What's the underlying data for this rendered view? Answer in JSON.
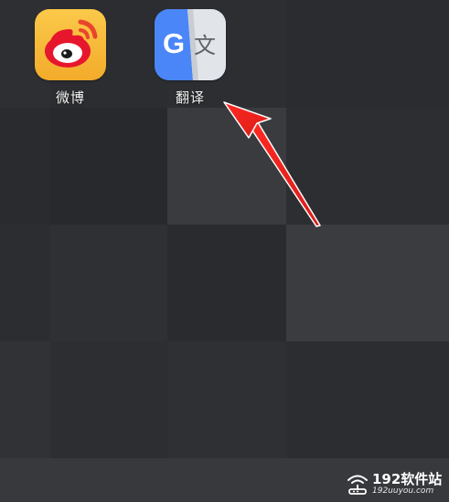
{
  "screen": {
    "background": "#2b2c30"
  },
  "apps": [
    {
      "label": "微博",
      "icon": "weibo-icon",
      "icon_bg": "#f6b739"
    },
    {
      "label": "翻译",
      "icon": "google-translate-icon",
      "icon_bg": "#4a86f7",
      "glyph_g": "G",
      "glyph_wen": "文"
    }
  ],
  "annotation": {
    "type": "red-arrow",
    "color": "#e8241f",
    "points_to": "翻译"
  },
  "watermark": {
    "name": "192软件站",
    "url": "192uuyou.com",
    "icon": "wifi-router-icon"
  }
}
